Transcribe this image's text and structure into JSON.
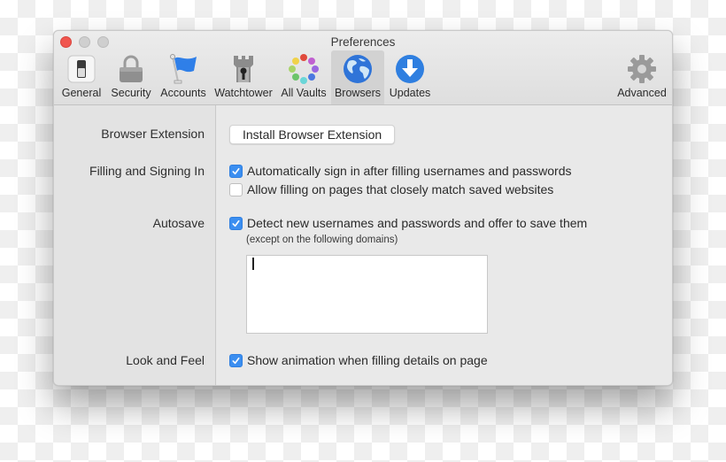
{
  "window": {
    "title": "Preferences",
    "traffic_lights": [
      "close",
      "minimize",
      "zoom"
    ]
  },
  "toolbar": {
    "items": [
      {
        "id": "general",
        "label": "General",
        "icon": "toggle-switch-icon",
        "selected": false
      },
      {
        "id": "security",
        "label": "Security",
        "icon": "padlock-icon",
        "selected": false
      },
      {
        "id": "accounts",
        "label": "Accounts",
        "icon": "flag-icon",
        "selected": false
      },
      {
        "id": "watchtower",
        "label": "Watchtower",
        "icon": "tower-keyhole-icon",
        "selected": false
      },
      {
        "id": "all-vaults",
        "label": "All Vaults",
        "icon": "colored-dots-ring-icon",
        "selected": false
      },
      {
        "id": "browsers",
        "label": "Browsers",
        "icon": "globe-icon",
        "selected": true
      },
      {
        "id": "updates",
        "label": "Updates",
        "icon": "download-arrow-icon",
        "selected": false
      },
      {
        "id": "advanced",
        "label": "Advanced",
        "icon": "gear-icon",
        "selected": false
      }
    ],
    "accent_color": "#3b8ef0"
  },
  "sections": {
    "browser_extension": {
      "label": "Browser Extension",
      "button_label": "Install Browser Extension"
    },
    "filling": {
      "label": "Filling and Signing In",
      "options": [
        {
          "label": "Automatically sign in after filling usernames and passwords",
          "checked": true
        },
        {
          "label": "Allow filling on pages that closely match saved websites",
          "checked": false
        }
      ]
    },
    "autosave": {
      "label": "Autosave",
      "option": {
        "label": "Detect new usernames and passwords and offer to save them",
        "checked": true
      },
      "note": "(except on the following domains)",
      "domains_value": ""
    },
    "look_and_feel": {
      "label": "Look and Feel",
      "option": {
        "label": "Show animation when filling details on page",
        "checked": true
      }
    }
  }
}
